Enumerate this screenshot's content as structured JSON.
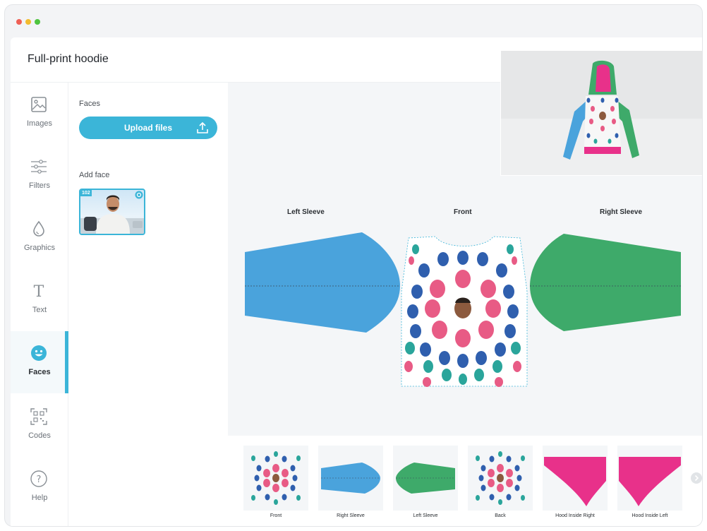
{
  "app": {
    "title": "Full-print hoodie"
  },
  "sidebar": {
    "items": [
      {
        "label": "Images",
        "icon": "image-icon",
        "active": false
      },
      {
        "label": "Filters",
        "icon": "sliders-icon",
        "active": false
      },
      {
        "label": "Graphics",
        "icon": "drop-icon",
        "active": false
      },
      {
        "label": "Text",
        "icon": "text-t-icon",
        "active": false
      },
      {
        "label": "Faces",
        "icon": "smiley-icon",
        "active": true
      },
      {
        "label": "Codes",
        "icon": "qr-code-icon",
        "active": false
      },
      {
        "label": "Help",
        "icon": "question-icon",
        "active": false
      }
    ]
  },
  "panel": {
    "section_title": "Faces",
    "upload_label": "Upload files",
    "add_face_label": "Add face",
    "face_badge": "102"
  },
  "canvas": {
    "left_sleeve": "Left Sleeve",
    "front": "Front",
    "right_sleeve": "Right Sleeve"
  },
  "thumbnails": [
    {
      "label": "Front"
    },
    {
      "label": "Right Sleeve"
    },
    {
      "label": "Left Sleeve"
    },
    {
      "label": "Back"
    },
    {
      "label": "Hood Inside Right"
    },
    {
      "label": "Hood Inside Left"
    }
  ],
  "colors": {
    "accent": "#3bb5d8",
    "sleeve_blue": "#4aa3dc",
    "sleeve_green": "#3eaa6a",
    "hood_pink": "#e8318a",
    "face_blue": "#2f5fae",
    "face_pink": "#e85b85",
    "face_teal": "#2aa59b"
  }
}
